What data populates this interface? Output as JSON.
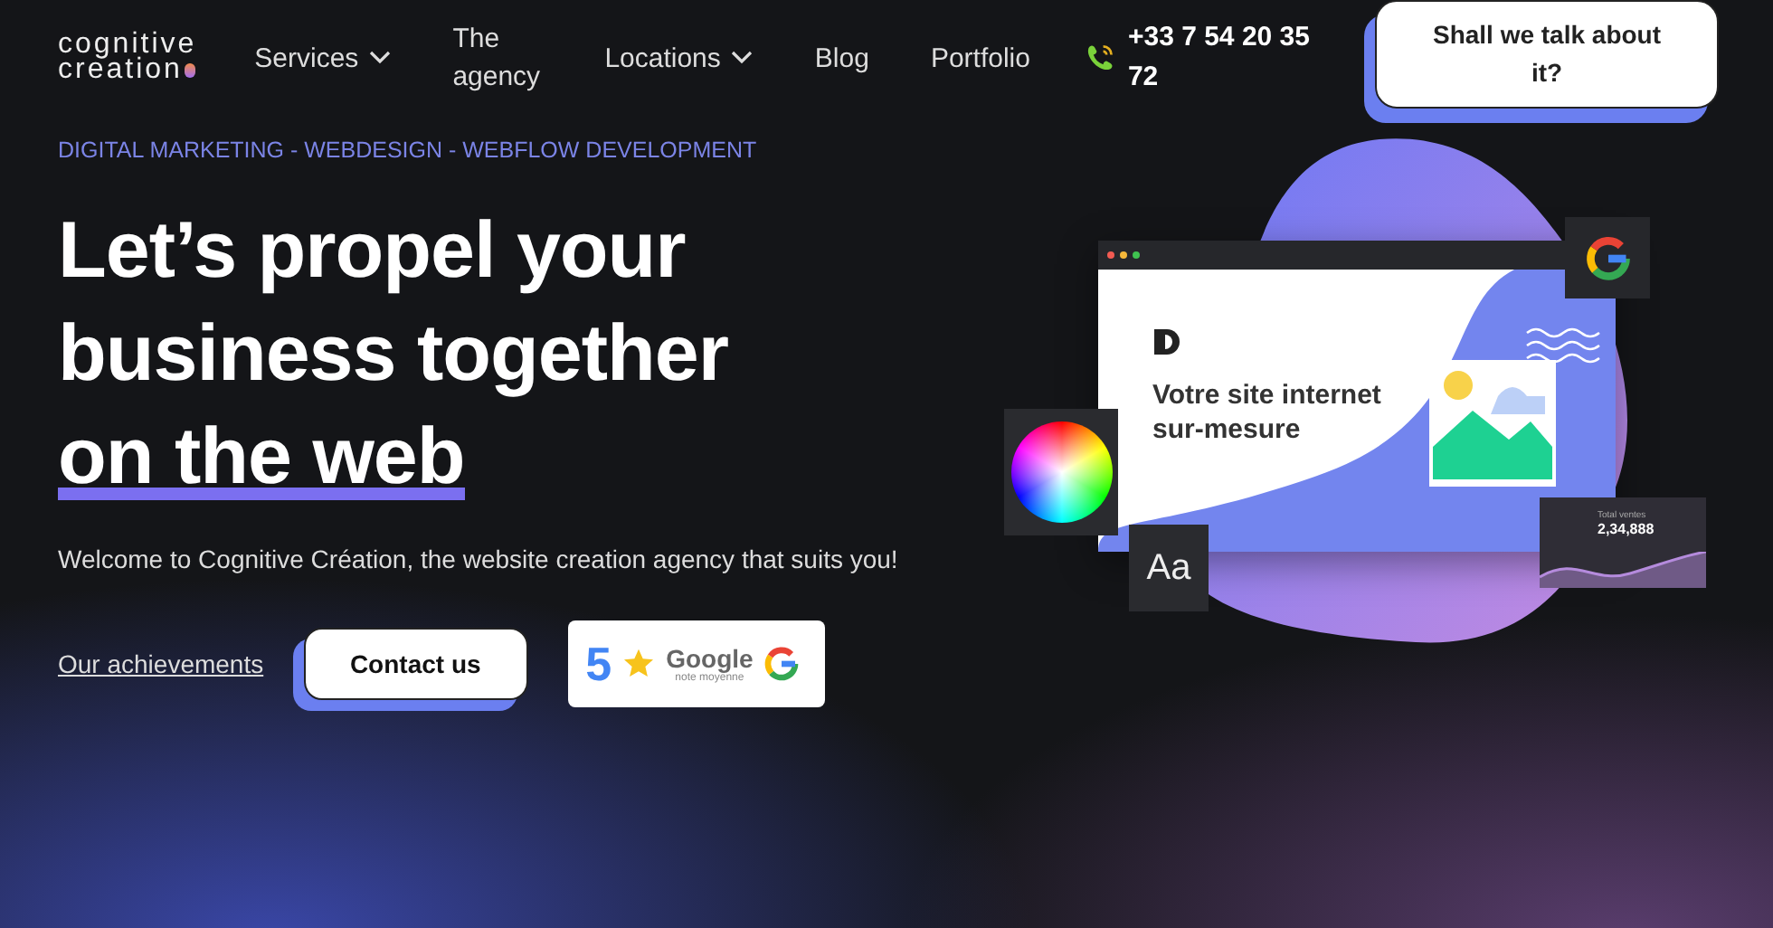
{
  "logo": {
    "line1": "cognitive",
    "line2": "creation"
  },
  "nav": [
    {
      "label": "Services",
      "dropdown": true
    },
    {
      "label": "The agency",
      "dropdown": false
    },
    {
      "label": "Locations",
      "dropdown": true
    },
    {
      "label": "Blog",
      "dropdown": false
    },
    {
      "label": "Portfolio",
      "dropdown": false
    }
  ],
  "phone": "+33 7 54 20 35 72",
  "cta": "Shall we talk about it?",
  "hero": {
    "eyebrow": "DIGITAL MARKETING - WEBDESIGN - WEBFLOW DEVELOPMENT",
    "title_lines": [
      "Let’s propel your",
      "business together"
    ],
    "title_highlight": "on the web",
    "subtitle": "Welcome to Cognitive Création, the website creation agency that suits you!",
    "link": "Our achievements",
    "button": "Contact us",
    "rating": {
      "score": "5",
      "brand": "Google",
      "caption": "note moyenne"
    }
  },
  "illustration": {
    "headline": "Votre site internet sur-mesure",
    "font_sample": "Aa",
    "stat_label": "Total ventes",
    "stat_value": "2,34,888"
  }
}
